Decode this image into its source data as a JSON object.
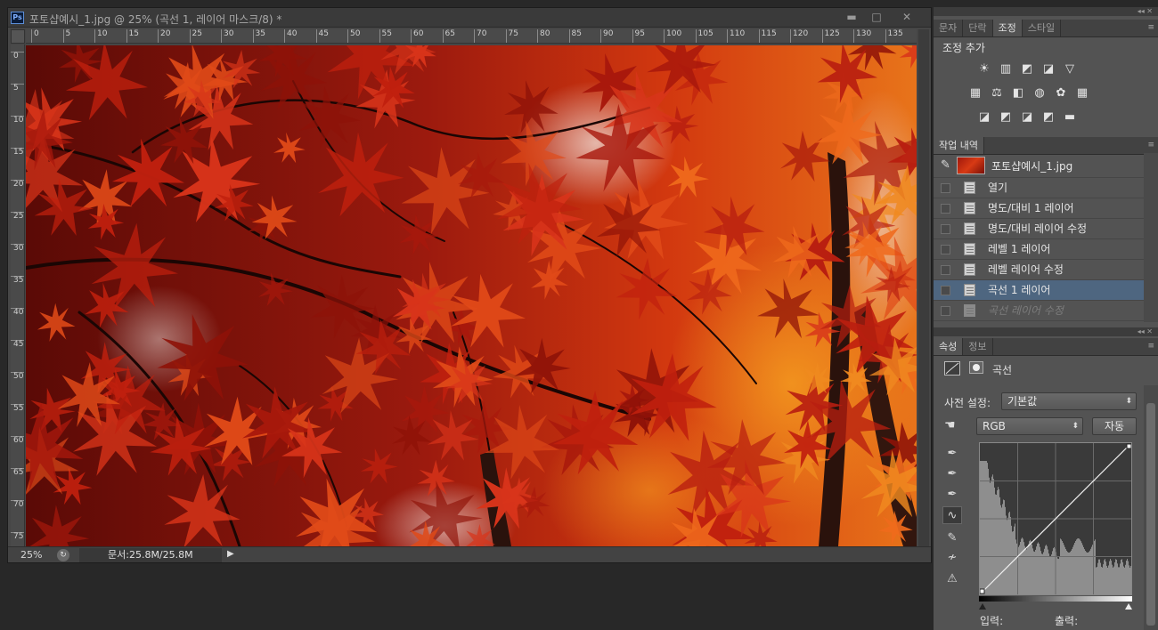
{
  "document": {
    "title": "포토샵예시_1.jpg @ 25% (곡선 1, 레이어 마스크/8) *",
    "app_icon": "Ps",
    "window_controls": {
      "minimize": "▬",
      "maximize": "□",
      "close": "✕"
    },
    "ruler_h": [
      "0",
      "5",
      "10",
      "15",
      "20",
      "25",
      "30",
      "35",
      "40",
      "45",
      "50",
      "55",
      "60",
      "65",
      "70",
      "75",
      "80",
      "85",
      "90",
      "95",
      "100",
      "105",
      "110",
      "115",
      "120",
      "125",
      "130",
      "135"
    ],
    "ruler_v": [
      "0",
      "5",
      "10",
      "15",
      "20",
      "25",
      "30",
      "35",
      "40",
      "45",
      "50",
      "55",
      "60",
      "65",
      "70",
      "75"
    ],
    "status": {
      "zoom": "25%",
      "doc_size": "문서:25.8M/25.8M",
      "arrow": "▶"
    }
  },
  "adjustments_panel": {
    "tabs": [
      "문자",
      "단락",
      "조정",
      "스타일"
    ],
    "active_tab": 2,
    "title": "조정 추가",
    "icons_row1": [
      "☀",
      "▥",
      "◩",
      "◪",
      "▽"
    ],
    "icons_row2": [
      "▦",
      "⚖",
      "◧",
      "◍",
      "✿",
      "▦"
    ],
    "icons_row3": [
      "◪",
      "◩",
      "◪",
      "◩",
      "▬"
    ]
  },
  "history_panel": {
    "tab": "작업 내역",
    "snapshot": "포토샵예시_1.jpg",
    "items": [
      "열기",
      "명도/대비 1 레이어",
      "명도/대비 레이어 수정",
      "레벨 1 레이어",
      "레벨 레이어 수정",
      "곡선 1 레이어",
      "곡선 레이어 수정"
    ],
    "selected_index": 5
  },
  "properties_panel": {
    "tabs": [
      "속성",
      "정보"
    ],
    "title": "곡선",
    "preset_label": "사전 설정:",
    "preset_value": "기본값",
    "channel": "RGB",
    "auto_button": "자동",
    "input_label": "입력:",
    "output_label": "출력:"
  },
  "colors": {
    "selection": "#4e6680",
    "panel_bg": "#535353",
    "app_bg": "#282828"
  }
}
